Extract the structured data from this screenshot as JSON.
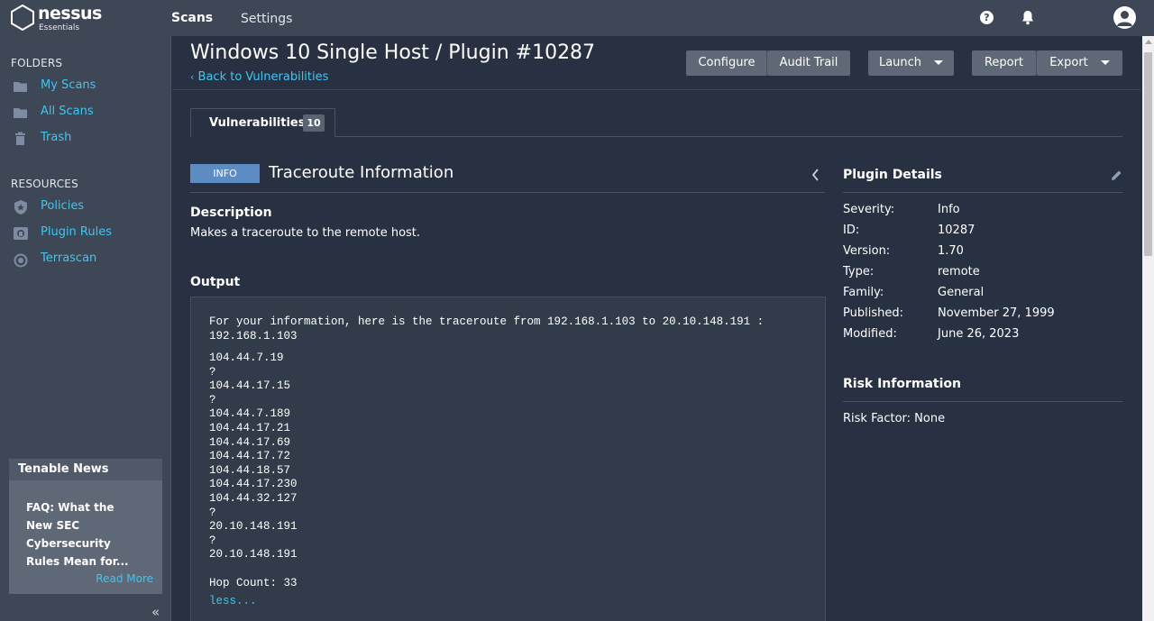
{
  "app": {
    "logo_text": "nessus",
    "logo_sub": "Essentials"
  },
  "topnav": {
    "scans": "Scans",
    "settings": "Settings",
    "help_icon": "question-icon",
    "bell_icon": "bell-icon",
    "user_icon": "user-icon"
  },
  "sidebar": {
    "folders_heading": "FOLDERS",
    "folders": [
      {
        "label": "My Scans",
        "icon": "folder-icon"
      },
      {
        "label": "All Scans",
        "icon": "folder-icon"
      },
      {
        "label": "Trash",
        "icon": "trash-icon"
      }
    ],
    "resources_heading": "RESOURCES",
    "resources": [
      {
        "label": "Policies",
        "icon": "policy-shield-icon"
      },
      {
        "label": "Plugin Rules",
        "icon": "plugin-rules-icon"
      },
      {
        "label": "Terrascan",
        "icon": "terrascan-icon"
      }
    ],
    "news": {
      "title": "Tenable News",
      "headline": "FAQ: What the New SEC Cybersecurity Rules Mean for...",
      "read_more": "Read More"
    },
    "collapse_label": "«"
  },
  "header": {
    "title": "Windows 10 Single Host / Plugin #10287",
    "back_link": "Back to Vulnerabilities",
    "buttons": {
      "configure": "Configure",
      "audit_trail": "Audit Trail",
      "launch": "Launch",
      "report": "Report",
      "export": "Export"
    }
  },
  "tabs": [
    {
      "label": "Vulnerabilities",
      "count": "10"
    }
  ],
  "vulnerability": {
    "severity": "INFO",
    "title": "Traceroute Information",
    "description_heading": "Description",
    "description": "Makes a traceroute to the remote host.",
    "output_heading": "Output",
    "output_header": [
      "For your information, here is the traceroute from 192.168.1.103 to 20.10.148.191 :",
      "192.168.1.103"
    ],
    "output_hops": [
      "104.44.7.19",
      "?",
      "104.44.17.15",
      "?",
      "104.44.7.189",
      "104.44.17.21",
      "104.44.17.69",
      "104.44.17.72",
      "104.44.18.57",
      "104.44.17.230",
      "104.44.32.127",
      "?",
      "20.10.148.191",
      "?",
      "20.10.148.191"
    ],
    "hop_count": "Hop Count: 33",
    "less_link": "less..."
  },
  "plugin_details": {
    "heading": "Plugin Details",
    "rows": [
      {
        "key": "Severity:",
        "value": "Info"
      },
      {
        "key": "ID:",
        "value": "10287"
      },
      {
        "key": "Version:",
        "value": "1.70"
      },
      {
        "key": "Type:",
        "value": "remote"
      },
      {
        "key": "Family:",
        "value": "General"
      },
      {
        "key": "Published:",
        "value": "November 27, 1999"
      },
      {
        "key": "Modified:",
        "value": "June 26, 2023"
      }
    ]
  },
  "risk_information": {
    "heading": "Risk Information",
    "risk_factor": "Risk Factor: None"
  },
  "colors": {
    "link": "#41c5f0",
    "info_badge": "#5d8cc4",
    "background": "#273142",
    "sidebar": "#3e4755"
  }
}
